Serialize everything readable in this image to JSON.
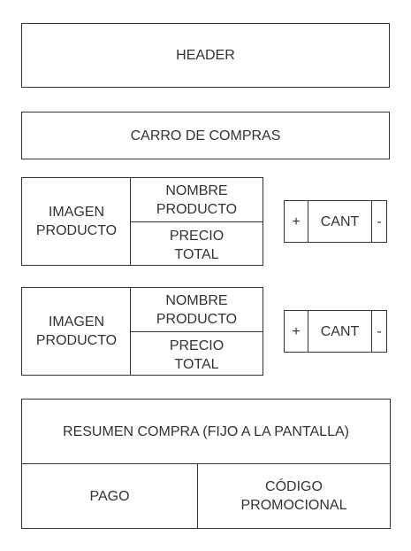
{
  "header": {
    "label": "HEADER"
  },
  "cart_title": {
    "label": "CARRO DE COMPRAS"
  },
  "products": [
    {
      "image_label": "IMAGEN\nPRODUCTO",
      "name_label": "NOMBRE\nPRODUCTO",
      "price_label": "PRECIO\nTOTAL",
      "plus_label": "+",
      "qty_label": "CANT",
      "minus_label": "-"
    },
    {
      "image_label": "IMAGEN\nPRODUCTO",
      "name_label": "NOMBRE\nPRODUCTO",
      "price_label": "PRECIO\nTOTAL",
      "plus_label": "+",
      "qty_label": "CANT",
      "minus_label": "-"
    }
  ],
  "summary": {
    "title": "RESUMEN COMPRA (FIJO A LA PANTALLA)",
    "payment_label": "PAGO",
    "promo_label": "CÓDIGO\nPROMOCIONAL"
  }
}
